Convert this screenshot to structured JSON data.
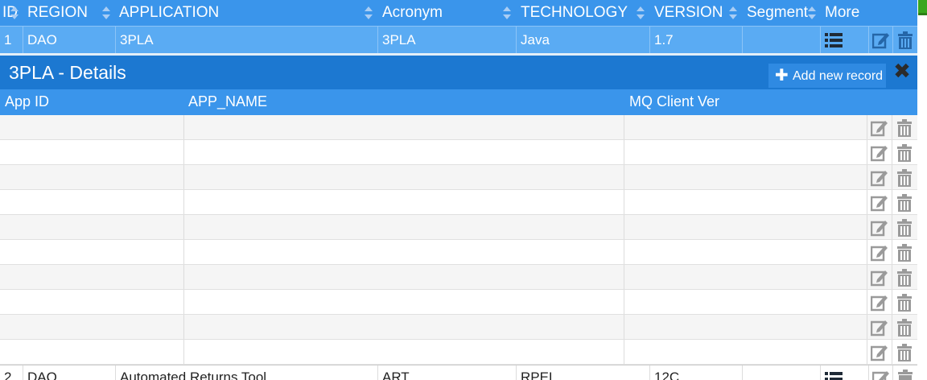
{
  "main_table": {
    "columns": [
      "ID",
      "REGION",
      "APPLICATION",
      "Acronym",
      "TECHNOLOGY",
      "VERSION",
      "Segment",
      "More"
    ],
    "selected_row": {
      "id": "1",
      "region": "DAO",
      "application": "3PLA",
      "acronym": "3PLA",
      "technology": "Java",
      "version": "1.7",
      "segment": ""
    },
    "next_row": {
      "id": "2",
      "region": "DAO",
      "application": "Automated Returns Tool",
      "acronym": "ART",
      "technology": "RPEL",
      "version": "12C",
      "segment": ""
    }
  },
  "details": {
    "title": "3PLA - Details",
    "add_button": "Add new record",
    "columns": [
      "App ID",
      "APP_NAME",
      "MQ Client Ver"
    ],
    "rows": [
      {
        "app_id": "",
        "app_name": "",
        "mq_client_ver": ""
      },
      {
        "app_id": "",
        "app_name": "",
        "mq_client_ver": ""
      },
      {
        "app_id": "",
        "app_name": "",
        "mq_client_ver": ""
      },
      {
        "app_id": "",
        "app_name": "",
        "mq_client_ver": ""
      },
      {
        "app_id": "",
        "app_name": "",
        "mq_client_ver": ""
      },
      {
        "app_id": "",
        "app_name": "",
        "mq_client_ver": ""
      },
      {
        "app_id": "",
        "app_name": "",
        "mq_client_ver": ""
      },
      {
        "app_id": "",
        "app_name": "",
        "mq_client_ver": ""
      },
      {
        "app_id": "",
        "app_name": "",
        "mq_client_ver": ""
      },
      {
        "app_id": "",
        "app_name": "",
        "mq_client_ver": ""
      }
    ]
  },
  "icons": {
    "sort": "sort-icon",
    "more": "list-icon",
    "edit": "edit-icon",
    "delete": "trash-icon",
    "add": "plus-icon",
    "close": "close-icon"
  },
  "colors": {
    "header_blue": "#3a95eb",
    "selected_row_blue": "#5aabf3",
    "details_title_blue": "#1c78d1",
    "icon_gray": "#9a9a9a"
  }
}
